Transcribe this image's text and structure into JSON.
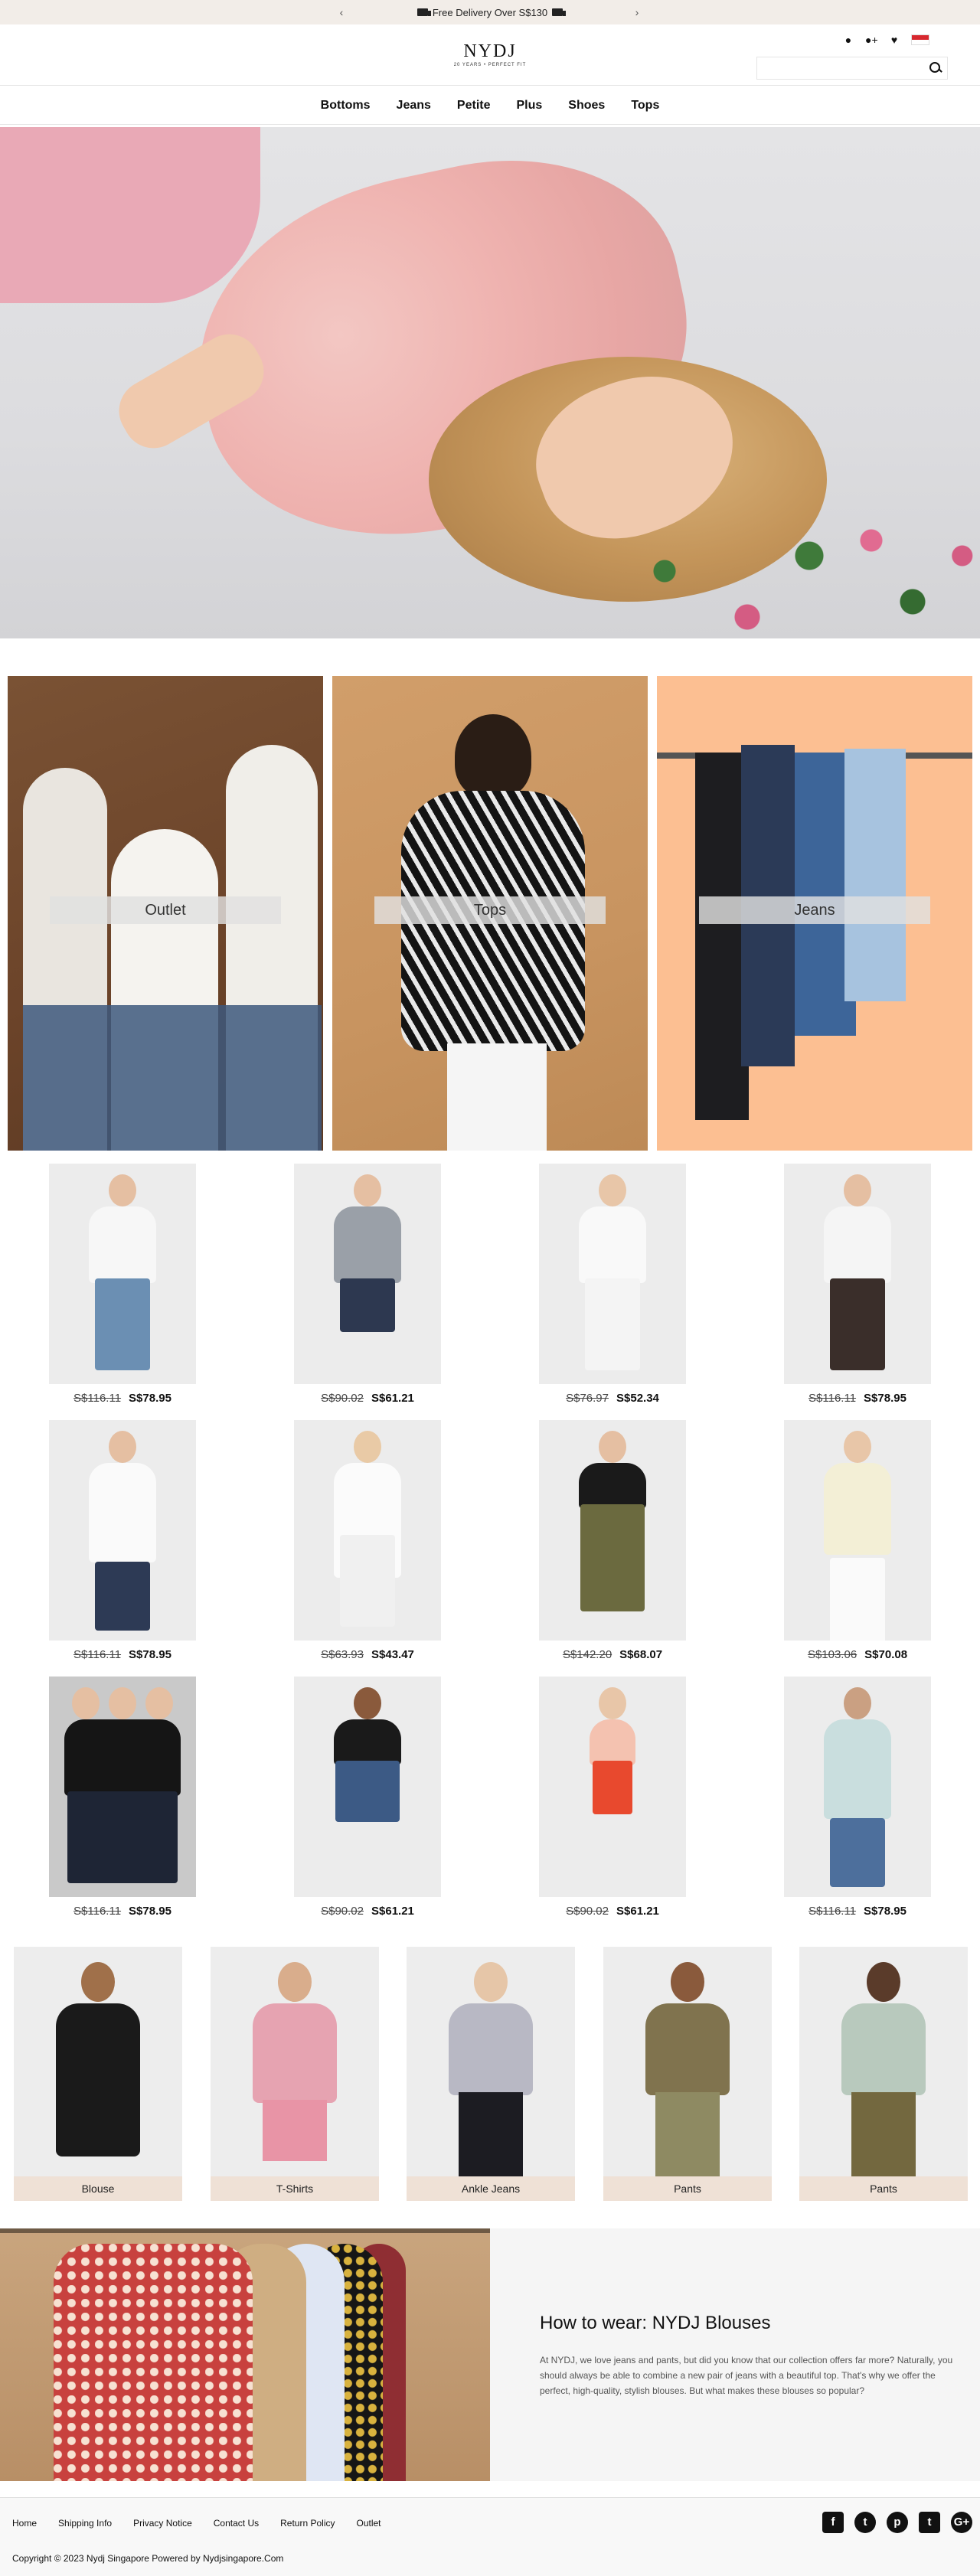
{
  "topbar": {
    "message": "Free Delivery Over S$130",
    "prev": "‹",
    "next": "›"
  },
  "header": {
    "logo": "NYDJ",
    "tagline": "20 YEARS • PERFECT FIT",
    "search_placeholder": "",
    "icons": [
      "account-icon",
      "add-user-icon",
      "heart-icon",
      "singapore-flag-icon",
      "search-icon"
    ]
  },
  "nav": {
    "items": [
      "Bottoms",
      "Jeans",
      "Petite",
      "Plus",
      "Shoes",
      "Tops"
    ]
  },
  "categories": [
    "Outlet",
    "Tops",
    "Jeans"
  ],
  "products": [
    {
      "old": "S$116.11",
      "new": "S$78.95"
    },
    {
      "old": "S$90.02",
      "new": "S$61.21"
    },
    {
      "old": "S$76.97",
      "new": "S$52.34"
    },
    {
      "old": "S$116.11",
      "new": "S$78.95"
    },
    {
      "old": "S$116.11",
      "new": "S$78.95"
    },
    {
      "old": "S$63.93",
      "new": "S$43.47"
    },
    {
      "old": "S$142.20",
      "new": "S$68.07"
    },
    {
      "old": "S$103.06",
      "new": "S$70.08"
    },
    {
      "old": "S$116.11",
      "new": "S$78.95"
    },
    {
      "old": "S$90.02",
      "new": "S$61.21"
    },
    {
      "old": "S$90.02",
      "new": "S$61.21"
    },
    {
      "old": "S$116.11",
      "new": "S$78.95"
    }
  ],
  "styles": [
    "Blouse",
    "T-Shirts",
    "Ankle Jeans",
    "Pants",
    "Pants"
  ],
  "carousel": {
    "prev": "‹",
    "next": "›"
  },
  "blog": {
    "title": "How to wear: NYDJ Blouses",
    "text": "At NYDJ, we love jeans and pants, but did you know that our collection offers far more? Naturally, you should always be able to combine a new pair of jeans with a beautiful top. That's why we offer the perfect, high-quality, stylish blouses. But what makes these blouses so popular?"
  },
  "footer": {
    "links": [
      "Home",
      "Shipping Info",
      "Privacy Notice",
      "Contact Us",
      "Return Policy",
      "Outlet"
    ],
    "copyright": "Copyright © 2023 Nydj Singapore Powered by Nydjsingapore.Com",
    "social": {
      "facebook": "f",
      "twitter": "t",
      "pinterest": "p",
      "tumblr": "t",
      "googleplus": "G+"
    }
  },
  "colors": {
    "topbar_bg": "#f2ede8",
    "label_bg": "#efe1d6",
    "text": "#111111"
  }
}
